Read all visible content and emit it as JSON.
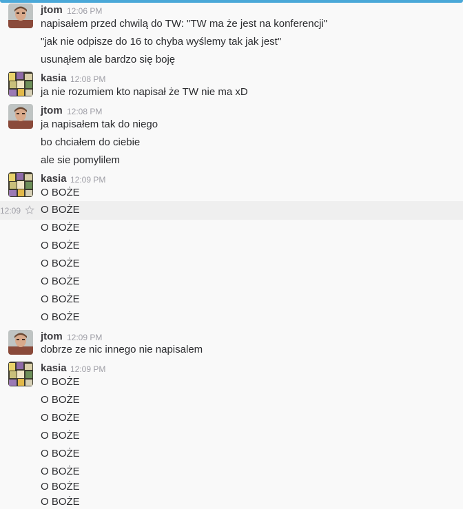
{
  "groups": [
    {
      "author": "jtom",
      "time": "12:06 PM",
      "avatar": "jtom-avatar",
      "messages": [
        "napisałem przed chwilą do TW: \"TW ma że jest na konferencji\"",
        "\"jak nie odpisze do 16 to chyba wyślemy tak jak jest\"",
        "usunąłem ale bardzo się boję"
      ]
    },
    {
      "author": "kasia",
      "time": "12:08 PM",
      "avatar": "kasia-avatar",
      "messages": [
        "ja nie rozumiem kto napisał że TW nie ma xD"
      ]
    },
    {
      "author": "jtom",
      "time": "12:08 PM",
      "avatar": "jtom-avatar",
      "messages": [
        "ja napisałem tak do niego",
        "bo chciałem do ciebie",
        "ale sie pomylilem"
      ]
    },
    {
      "author": "kasia",
      "time": "12:09 PM",
      "avatar": "kasia-avatar",
      "messages": [
        "O BOŻE",
        "O BOŻE",
        "O BOŻE",
        "O BOŻE",
        "O BOŻE",
        "O BOŻE",
        "O BOŻE",
        "O BOŻE"
      ]
    },
    {
      "author": "jtom",
      "time": "12:09 PM",
      "avatar": "jtom-avatar",
      "messages": [
        "dobrze ze nic innego nie napisalem"
      ]
    },
    {
      "author": "kasia",
      "time": "12:09 PM",
      "avatar": "kasia-avatar",
      "messages": [
        "O BOŻE",
        "O BOŻE",
        "O BOŻE",
        "O BOŻE",
        "O BOŻE",
        "O BOŻE",
        "O BOŻE",
        "O BOŻE"
      ]
    }
  ],
  "hover": {
    "time": "12:09",
    "icon": "star-icon"
  },
  "colors": {
    "accent": "#4aa8d8",
    "hover_row": "#efefef",
    "timestamp": "#9e9ea6"
  }
}
